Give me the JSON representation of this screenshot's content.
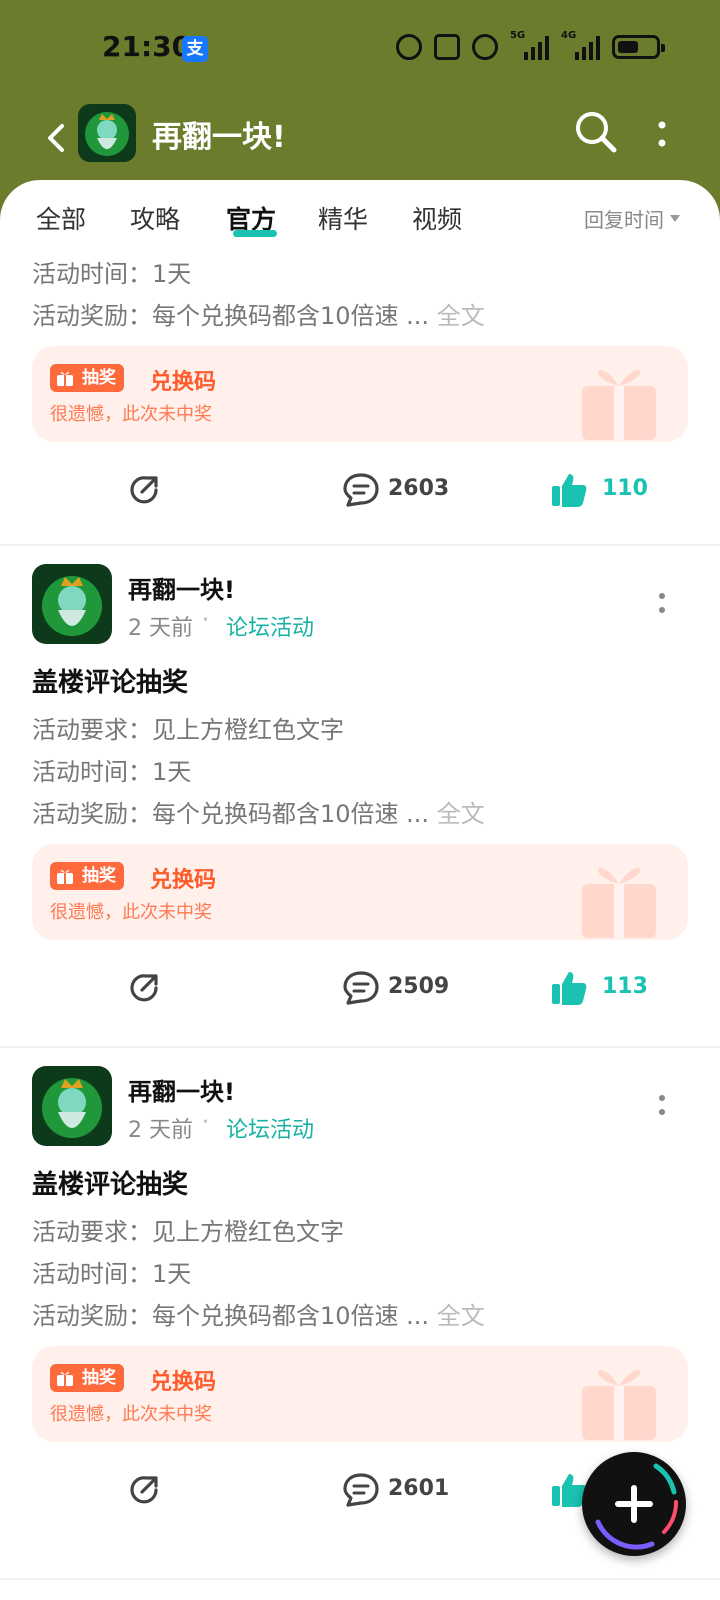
{
  "status_bar": {
    "time": "21:30",
    "alipay_badge": "支",
    "network_5g": "5G",
    "network_4g": "4G",
    "battery_level": 0.55
  },
  "header": {
    "title": "再翻一块!"
  },
  "tabs": [
    {
      "label": "全部",
      "active": false
    },
    {
      "label": "攻略",
      "active": false
    },
    {
      "label": "官方",
      "active": true
    },
    {
      "label": "精华",
      "active": false
    },
    {
      "label": "视频",
      "active": false
    }
  ],
  "sort": {
    "label": "回复时间"
  },
  "posts": [
    {
      "partial": true,
      "lines": [
        "活动时间：1天",
        "活动奖励：每个兑换码都含10倍速 ..."
      ],
      "more": "全文",
      "lottery": {
        "badge": "抽奖",
        "prize": "兑换码",
        "result": "很遗憾，此次未中奖"
      },
      "comments": "2603",
      "likes": "110"
    },
    {
      "author": "再翻一块!",
      "time": "2 天前",
      "category": "论坛活动",
      "title": "盖楼评论抽奖",
      "lines": [
        "活动要求：见上方橙红色文字",
        "活动时间：1天",
        "活动奖励：每个兑换码都含10倍速 ..."
      ],
      "more": "全文",
      "lottery": {
        "badge": "抽奖",
        "prize": "兑换码",
        "result": "很遗憾，此次未中奖"
      },
      "comments": "2509",
      "likes": "113"
    },
    {
      "author": "再翻一块!",
      "time": "2 天前",
      "category": "论坛活动",
      "title": "盖楼评论抽奖",
      "lines": [
        "活动要求：见上方橙红色文字",
        "活动时间：1天",
        "活动奖励：每个兑换码都含10倍速 ..."
      ],
      "more": "全文",
      "lottery": {
        "badge": "抽奖",
        "prize": "兑换码",
        "result": "很遗憾，此次未中奖"
      },
      "comments": "2601",
      "likes": ""
    }
  ],
  "colors": {
    "header_bg": "#6b7c2c",
    "accent": "#19c2b1",
    "lottery_orange": "#ff6a3d"
  },
  "icons": {
    "back": "back-arrow-icon",
    "search": "search-icon",
    "more": "more-vertical-icon",
    "share": "share-icon",
    "comment": "comment-icon",
    "like": "thumbs-up-icon",
    "gift": "gift-icon",
    "create": "plus-icon"
  }
}
